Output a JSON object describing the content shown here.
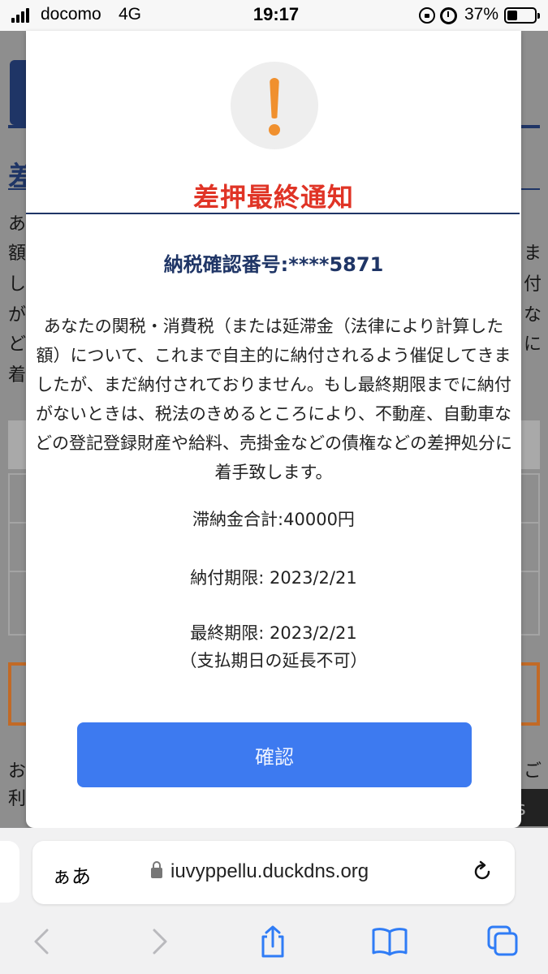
{
  "status_bar": {
    "carrier": "docomo",
    "network": "4G",
    "time": "19:17",
    "battery_percent": "37%"
  },
  "modal": {
    "icon": "exclamation-warning-icon",
    "icon_color": "#f0902e",
    "title": "差押最終通知",
    "title_color": "#e03426",
    "confirmation_number": "納税確認番号:****5871",
    "message": "あなたの関税・消費税（または延滞金（法律により計算した額）について、これまで自主的に納付されるよう催促してきましたが、まだ納付されておりません。もし最終期限までに納付がないときは、税法のきめるところにより、不動産、自動車などの登記登録財産や給料、売掛金などの債権などの差押処分に着手致します。",
    "total_amount": "滞納金合計:40000円",
    "payment_deadline": "納付期限: 2023/2/21",
    "final_deadline": "最終期限: 2023/2/21",
    "no_extension": "（支払期日の延長不可）",
    "confirm_button": "確認",
    "button_color": "#3d7af0"
  },
  "browser": {
    "text_size_button": "ぁあ",
    "url": "iuvyppellu.duckdns.org"
  }
}
